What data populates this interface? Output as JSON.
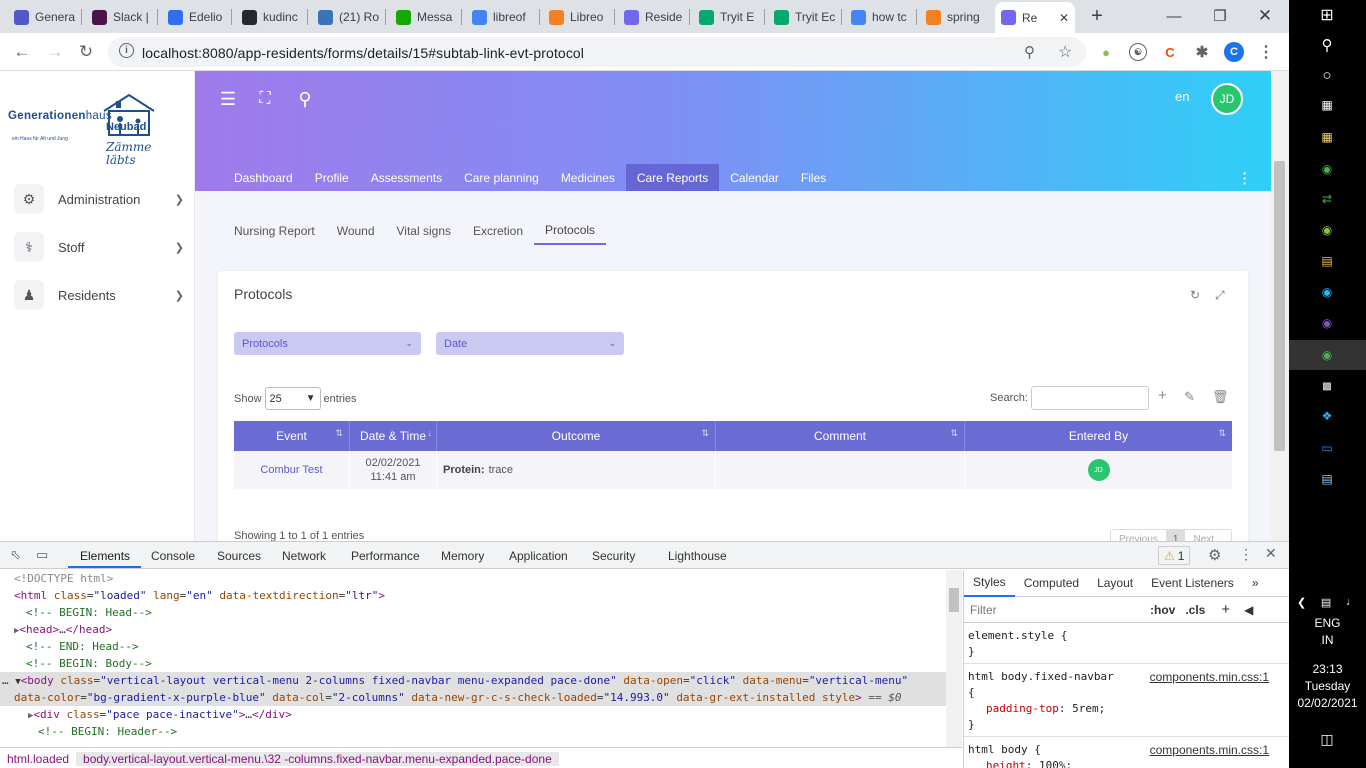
{
  "browser": {
    "tabs": [
      {
        "label": "Genera",
        "color": "#5059c9"
      },
      {
        "label": "Slack |",
        "color": "#4a154b"
      },
      {
        "label": "Edelio",
        "color": "#2f6fed"
      },
      {
        "label": "kudinc",
        "color": "#24292e"
      },
      {
        "label": "(21) Ro",
        "color": "#3b73b9"
      },
      {
        "label": "Messa",
        "color": "#14a800"
      },
      {
        "label": "libreof",
        "color": "#4285f4"
      },
      {
        "label": "Libreo",
        "color": "#f48024"
      },
      {
        "label": "Reside",
        "color": "#7367f0"
      },
      {
        "label": "Tryit E",
        "color": "#04aa6d"
      },
      {
        "label": "Tryit Ec",
        "color": "#04aa6d"
      },
      {
        "label": "how tc",
        "color": "#4285f4"
      },
      {
        "label": "spring",
        "color": "#f48024"
      },
      {
        "label": "Re",
        "color": "#7367f0"
      }
    ],
    "new_tab": "+",
    "url": "localhost:8080/app-residents/forms/details/15#subtab-link-evt-protocol",
    "profile_initial": "C"
  },
  "sidebar": {
    "logo": {
      "line1": "Generationen",
      "line2": "haus",
      "line3": "Neubad",
      "tagline": "ein Haus für Alt und Jung",
      "script": "Zämme läbts"
    },
    "items": [
      {
        "label": "Administration",
        "icon": "gear-icon"
      },
      {
        "label": "Stoff",
        "icon": "stethoscope-icon"
      },
      {
        "label": "Residents",
        "icon": "users-icon"
      }
    ]
  },
  "header": {
    "lang": "en",
    "avatar": "JD",
    "nav": [
      "Dashboard",
      "Profile",
      "Assessments",
      "Care planning",
      "Medicines",
      "Care Reports",
      "Calendar",
      "Files"
    ],
    "active_nav": "Care Reports"
  },
  "subtabs": [
    "Nursing Report",
    "Wound",
    "Vital signs",
    "Excretion",
    "Protocols"
  ],
  "active_subtab": "Protocols",
  "card": {
    "title": "Protocols",
    "filters": [
      "Protocols",
      "Date"
    ],
    "show_label": "Show",
    "show_value": "25",
    "entries_label": "entries",
    "search_label": "Search:",
    "columns": [
      "Event",
      "Date & Time",
      "Outcome",
      "Comment",
      "Entered By"
    ],
    "rows": [
      {
        "event": "Combur Test",
        "date": "02/02/2021",
        "time": "11:41 am",
        "outcome_key": "Protein:",
        "outcome_val": "trace",
        "comment": "",
        "entered_by": "JD"
      }
    ],
    "showing": "Showing 1 to 1 of 1 entries",
    "pager": {
      "prev": "Previous",
      "page": "1",
      "next": "Next"
    }
  },
  "devtools": {
    "tabs": [
      "Elements",
      "Console",
      "Sources",
      "Network",
      "Performance",
      "Memory",
      "Application",
      "Security",
      "Lighthouse"
    ],
    "warnings": "1",
    "breadcrumbs": [
      "html.loaded",
      "body.vertical-layout.vertical-menu.\\32 -columns.fixed-navbar.menu-expanded.pace-done"
    ],
    "styles_tabs": [
      "Styles",
      "Computed",
      "Layout",
      "Event Listeners"
    ],
    "filter_placeholder": "Filter",
    "hov": ":hov",
    "cls": ".cls",
    "rules": [
      {
        "selector": "element.style {",
        "source": "",
        "decls": [],
        "close": "}"
      },
      {
        "selector": "html body.fixed-navbar",
        "source": "components.min.css:1",
        "decls": [
          {
            "prop": "padding-top",
            "val": "5rem;"
          }
        ],
        "close": "}",
        "open": "{"
      },
      {
        "selector": "html body {",
        "source": "components.min.css:1",
        "decls": [
          {
            "prop": "height",
            "val": "100%;"
          }
        ],
        "close": ""
      }
    ]
  },
  "taskbar": {
    "lang": "ENG",
    "region": "IN",
    "time": "23:13",
    "day": "Tuesday",
    "date": "02/02/2021"
  }
}
